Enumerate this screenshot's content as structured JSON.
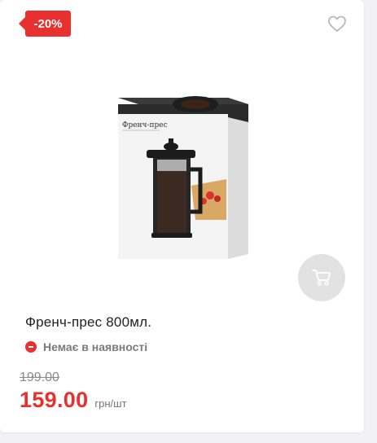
{
  "product": {
    "discount_badge": "-20%",
    "box_brand_text": "Френч-прес",
    "title": "Френч-прес 800мл.",
    "availability": "Немає в наявності",
    "old_price": "199.00",
    "price": "159.00",
    "unit": "грн/шт"
  },
  "colors": {
    "accent": "#e8302e",
    "card_bg": "#ffffff",
    "page_bg": "#f2f2f4",
    "cart_btn_bg": "#e2e2e2"
  },
  "icons": {
    "wishlist": "heart-icon",
    "cart": "cart-icon",
    "availability": "minus-circle-icon"
  }
}
